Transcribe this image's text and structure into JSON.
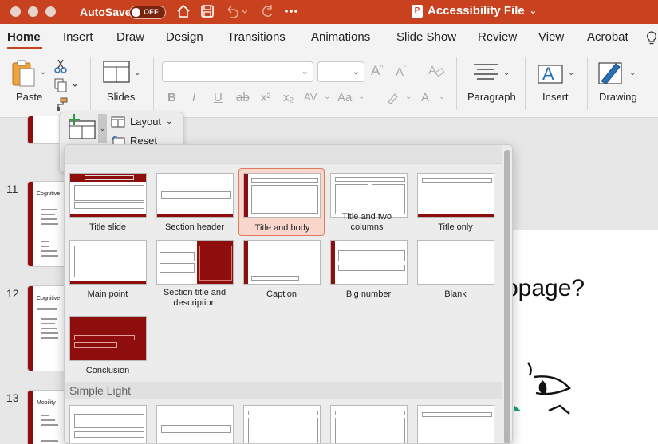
{
  "titlebar": {
    "autosave_label": "AutoSave",
    "autosave_state": "OFF",
    "doc_title": "Accessibility File",
    "doc_badge": "P"
  },
  "tabs": [
    {
      "label": "Home",
      "active": true
    },
    {
      "label": "Insert"
    },
    {
      "label": "Draw"
    },
    {
      "label": "Design"
    },
    {
      "label": "Transitions"
    },
    {
      "label": "Animations"
    },
    {
      "label": "Slide Show"
    },
    {
      "label": "Review"
    },
    {
      "label": "View"
    },
    {
      "label": "Acrobat"
    }
  ],
  "ribbon": {
    "paste_label": "Paste",
    "slides_label": "Slides",
    "paragraph_label": "Paragraph",
    "insert_label": "Insert",
    "drawing_label": "Drawing",
    "font_name_value": "",
    "font_size_value": "",
    "format_glyphs": [
      "B",
      "I",
      "U",
      "ab",
      "x²",
      "x₂",
      "AV",
      "Aa",
      "A"
    ]
  },
  "newslide_popup": {
    "layout_label": "Layout",
    "reset_label": "Reset"
  },
  "gallery": {
    "layouts": [
      {
        "name": "Title slide"
      },
      {
        "name": "Section header"
      },
      {
        "name": "Title and body",
        "selected": true
      },
      {
        "name": "Title and two columns"
      },
      {
        "name": "Title only"
      },
      {
        "name": "Main point"
      },
      {
        "name": "Section title and description"
      },
      {
        "name": "Caption"
      },
      {
        "name": "Big number"
      },
      {
        "name": "Blank"
      },
      {
        "name": "Conclusion"
      }
    ],
    "section2_title": "Simple Light"
  },
  "thumbnails": [
    {
      "number": "11",
      "title": "Cognitive"
    },
    {
      "number": "12",
      "title": "Cognitive"
    },
    {
      "number": "13",
      "title": "Mobility"
    }
  ],
  "slide": {
    "visible_text": "bpage?"
  },
  "colors": {
    "accent": "#c8421f",
    "theme_dark_red": "#8e0e0e",
    "selection": "#f8d6cc"
  }
}
